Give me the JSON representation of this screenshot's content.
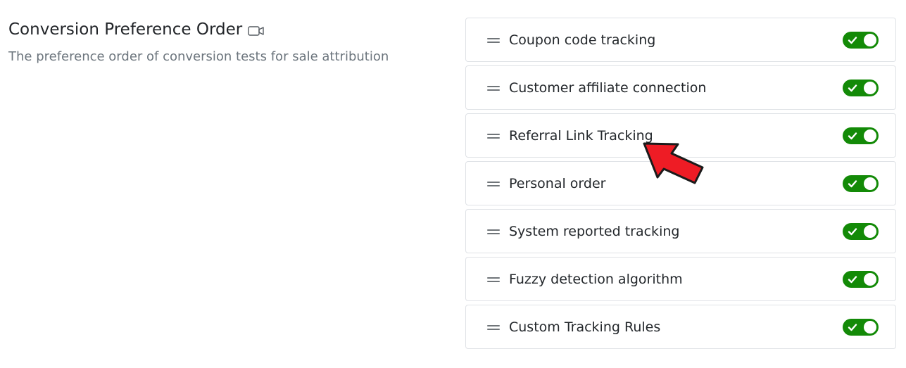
{
  "header": {
    "title": "Conversion Preference Order",
    "title_icon": "video-camera-icon",
    "subtitle": "The preference order of conversion tests for sale attribution"
  },
  "items": [
    {
      "label": "Coupon code tracking",
      "enabled": true
    },
    {
      "label": "Customer affiliate connection",
      "enabled": true
    },
    {
      "label": "Referral Link Tracking",
      "enabled": true
    },
    {
      "label": "Personal order",
      "enabled": true
    },
    {
      "label": "System reported tracking",
      "enabled": true
    },
    {
      "label": "Fuzzy detection algorithm",
      "enabled": true
    },
    {
      "label": "Custom Tracking Rules",
      "enabled": true
    }
  ],
  "colors": {
    "toggle_on": "#138a07",
    "annotation_arrow": "#ee1c25"
  },
  "annotation": {
    "icon": "red-pointer-arrow-icon",
    "points_to": "Referral Link Tracking"
  }
}
